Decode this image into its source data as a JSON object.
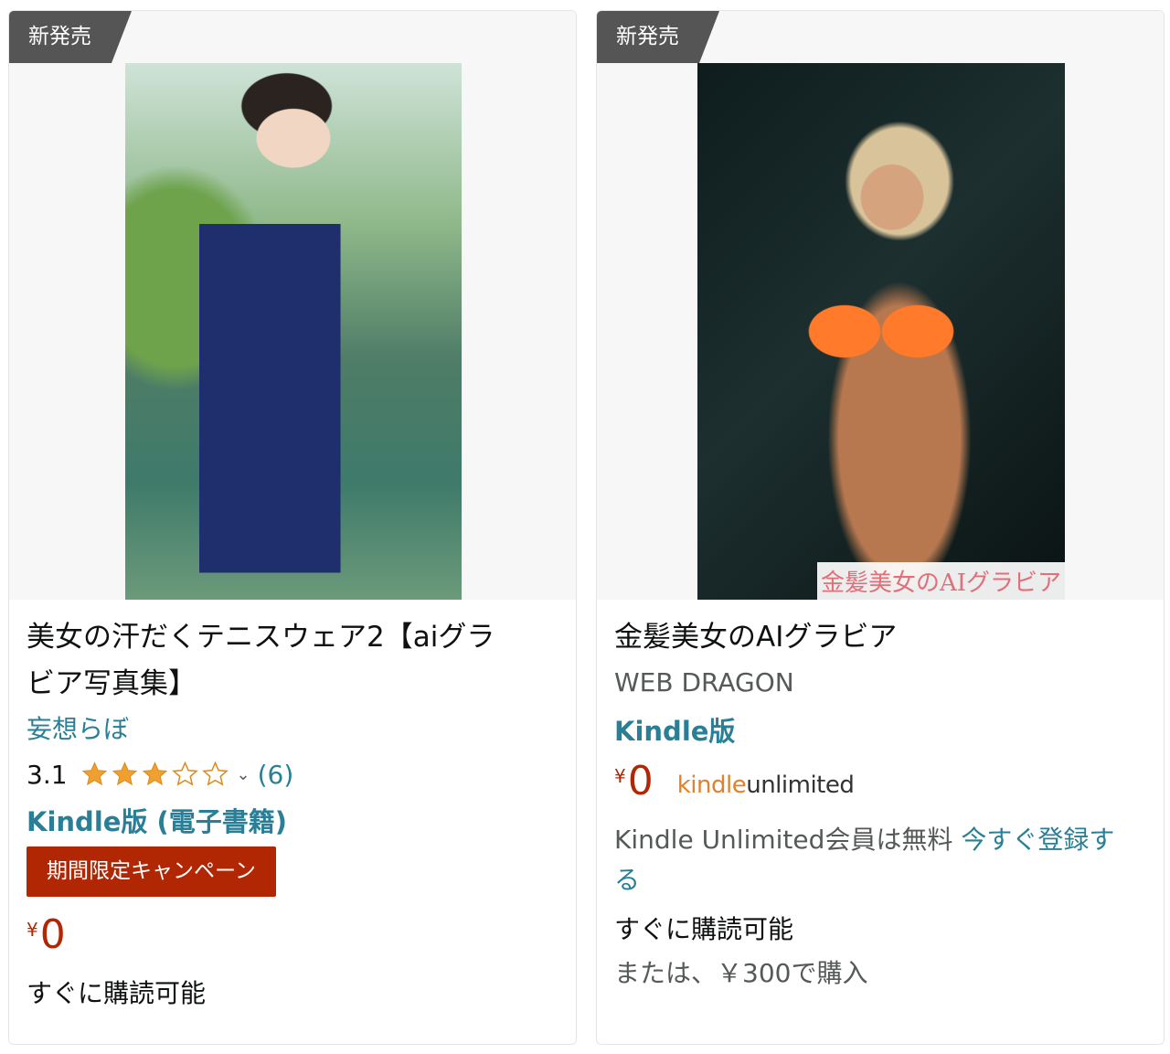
{
  "cards": [
    {
      "badge": "新発売",
      "title": "美女の汗だくテニスウェア2【aiグラビア写真集】",
      "title_line1": "美女の汗だくテニスウェア2【aiグラ",
      "title_line2": "ビア写真集】",
      "author": "妄想らぼ",
      "rating": "3.1",
      "stars": 3,
      "rating_count": "(6)",
      "format": "Kindle版 (電子書籍)",
      "campaign": "期間限定キャンペーン",
      "currency": "¥",
      "price": "0",
      "availability": "すぐに購読可能"
    },
    {
      "badge": "新発売",
      "title": "金髪美女のAIグラビア",
      "cover_caption": "金髪美女のAIグラビア",
      "author": "WEB DRAGON",
      "format": "Kindle版",
      "currency": "¥",
      "price": "0",
      "ku_logo_k": "kindle",
      "ku_logo_u": "unlimited",
      "ku_text": "Kindle Unlimited会員は無料",
      "ku_link_1": "今すぐ登録す",
      "ku_link_2": "る",
      "availability": "すぐに購読可能",
      "alt_buy": "または、￥300で購入"
    }
  ],
  "colors": {
    "link": "#2a7f96",
    "price": "#b12704",
    "badge": "#555555",
    "star": "#f0a030"
  },
  "icons": {
    "star_full": "star-icon",
    "star_empty": "star-outline-icon",
    "chevron": "chevron-down-icon"
  }
}
